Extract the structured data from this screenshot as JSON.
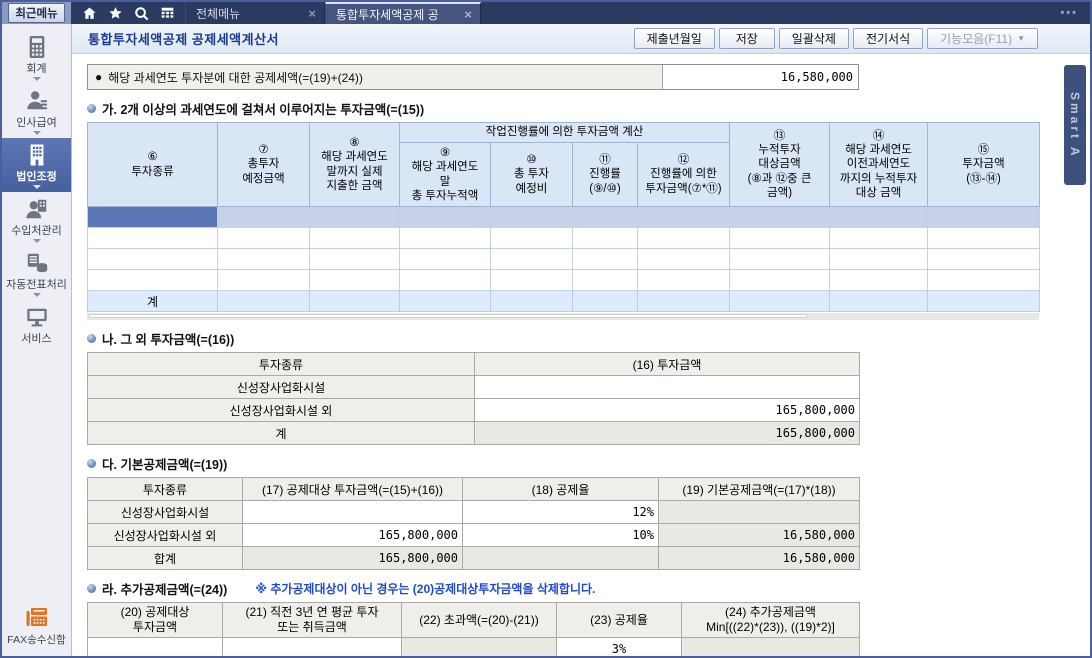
{
  "topbar": {
    "recent_menu_label": "최근메뉴",
    "icons": [
      "home",
      "star",
      "search",
      "menu-grid"
    ],
    "tabs": [
      {
        "label": "전체메뉴",
        "active": false
      },
      {
        "label": "통합투자세액공제 공",
        "active": true
      }
    ],
    "close_glyph": "×",
    "overflow_glyph": "•••"
  },
  "toolbar": {
    "title": "통합투자세액공제  공제세액계산서",
    "buttons": [
      "제출년월일",
      "저장",
      "일괄삭제",
      "전기서식"
    ],
    "function_button": "기능모음(F11)",
    "dropdown_glyph": "▼"
  },
  "sidebar": {
    "items": [
      {
        "label": "회계",
        "icon": "calculator",
        "selected": false
      },
      {
        "label": "인사급여",
        "icon": "person-payroll",
        "selected": false
      },
      {
        "label": "법인조정",
        "icon": "building",
        "selected": true
      },
      {
        "label": "수입처관리",
        "icon": "person-building",
        "selected": false
      },
      {
        "label": "자동전표처리",
        "icon": "database",
        "selected": false
      },
      {
        "label": "서비스",
        "icon": "monitor",
        "selected": false
      }
    ],
    "fax_label": "FAX송수신함",
    "fax_icon": "fax"
  },
  "summary": {
    "bullet": "●",
    "label": "해당 과세연도 투자분에 대한 공제세액(=(19)+(24))",
    "value": "16,580,000"
  },
  "section_ga": {
    "title": "가. 2개 이상의 과세연도에 걸쳐서 이루어지는 투자금액(=(15))",
    "group_header": "작업진행률에 의한 투자금액  계산",
    "columns": [
      "⑥\n투자종류",
      "⑦\n총투자\n예정금액",
      "⑧\n해당 과세연도\n말까지 실제\n지출한 금액",
      "⑨\n해당 과세연도\n말\n총 투자누적액",
      "⑩\n총 투자\n예정비",
      "⑪\n진행률\n(⑨/⑩)",
      "⑫\n진행률에 의한\n투자금액(⑦*⑪)",
      "⑬\n누적투자\n대상금액\n(⑧과 ⑫중 큰\n금액)",
      "⑭\n해당 과세연도\n이전과세연도\n까지의 누적투자\n대상 금액",
      "⑮\n투자금액\n(⑬-⑭)"
    ],
    "total_label": "계"
  },
  "section_na": {
    "title": "나. 그 외 투자금액(=(16))",
    "columns": [
      "투자종류",
      "(16) 투자금액"
    ],
    "rows": [
      [
        "신성장사업화시설",
        ""
      ],
      [
        "신성장사업화시설 외",
        "165,800,000"
      ],
      [
        "계",
        "165,800,000"
      ]
    ]
  },
  "section_da": {
    "title": "다. 기본공제금액(=(19))",
    "columns": [
      "투자종류",
      "(17) 공제대상 투자금액(=(15)+(16))",
      "(18) 공제율",
      "(19) 기본공제금액(=(17)*(18))"
    ],
    "rows": [
      [
        "신성장사업화시설",
        "",
        "12%",
        ""
      ],
      [
        "신성장사업화시설 외",
        "165,800,000",
        "10%",
        "16,580,000"
      ],
      [
        "합계",
        "165,800,000",
        "",
        "16,580,000"
      ]
    ]
  },
  "section_ra": {
    "title": "라. 추가공제금액(=(24))",
    "note": "※ 추가공제대상이 아닌 경우는 (20)공제대상투자금액을 삭제합니다.",
    "columns": [
      "(20) 공제대상\n투자금액",
      "(21) 직전 3년 연 평균 투자\n또는 취득금액",
      "(22) 초과액(=(20)-(21))",
      "(23) 공제율",
      "(24) 추가공제금액\nMin[((22)*(23)), ((19)*2)]"
    ],
    "row": [
      "",
      "",
      "",
      "3%",
      ""
    ]
  },
  "smart_tab": {
    "label": "Smart A"
  },
  "colors": {
    "titlebar": "#2b3a61",
    "active_tab": "#46557f",
    "selected_cell": "#5b77b5",
    "selected_row": "#c7d2e8",
    "table_header": "#d9e6f5",
    "total_row": "#dcebfd",
    "label_cell": "#efeee8",
    "readonly_cell": "#e9e8e2",
    "fax_icon": "#e2731c",
    "title_text": "#1b3a94",
    "note_text": "#1f49cf"
  }
}
